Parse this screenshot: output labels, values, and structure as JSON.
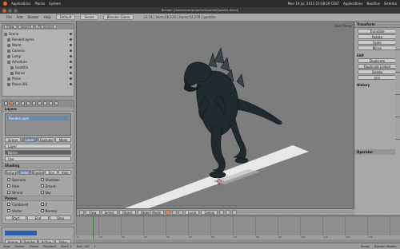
{
  "os_bar": {
    "app_name": "Applications",
    "menus": [
      "Places",
      "System"
    ],
    "right_items": [
      "Mon 19 Jul, 2013 22:38:20 CEST",
      "Applications",
      "Nautilus",
      "Sistema"
    ]
  },
  "window": {
    "title": "Blender [/home/user/projects/Godzilla/Godzilla.blend]"
  },
  "info_bar": {
    "menus": [
      "File",
      "Add",
      "Render",
      "Help"
    ],
    "layout": "Default",
    "scene": "Scene",
    "engine": "Blender Game",
    "stats": "v2.74 | Verts:26,126 | Faces:52,279 | godzilla"
  },
  "outliner": {
    "header_items": [
      "View",
      "Search",
      "All Scenes"
    ],
    "rows": [
      "Scene",
      "RenderLayers",
      "World",
      "Camera",
      "Lamp",
      "Armature",
      "Godzilla",
      "Bones",
      "Plane",
      "Plane.001"
    ]
  },
  "properties": {
    "layers_title": "Layers",
    "passes_title": "Render Layers",
    "list_selected": "RenderLayer",
    "buttons_row1": [
      "Scene",
      "Layer",
      "Exclude",
      "Mask"
    ],
    "field_layer": "Layer",
    "field_name": "Name",
    "field_use": "Use",
    "shading_title": "Shading",
    "shading_buttons": [
      "Texture",
      "Solid",
      "Shadow",
      "Env",
      "Halo"
    ],
    "checks": [
      "Specular",
      "Shadows",
      "Halo",
      "Zmask",
      "Strand",
      "Sky"
    ],
    "passes_label": "Passes",
    "passes_checks": [
      "Combined",
      "Z",
      "Vector",
      "Normal"
    ],
    "frame_buttons": [
      "Start",
      "End",
      "Step"
    ],
    "bottom_buttons": [
      "Image",
      "Render",
      "Active",
      "Bake"
    ]
  },
  "viewport": {
    "label": "User Persp",
    "header": [
      "View",
      "Select",
      "Object",
      "Object Mode",
      "Local",
      "Global"
    ],
    "mesh_name": "Godzilla"
  },
  "toolshelf": {
    "title": "Transform",
    "tools": [
      "Translate",
      "Rotate",
      "Scale",
      "Mirror"
    ],
    "edit_title": "Edit",
    "edit_tools": [
      "Duplicate",
      "Duplicate Linked",
      "Delete",
      "Join"
    ],
    "history_title": "History",
    "options_title": "Operator"
  },
  "timeline": {
    "ruler": [
      "0",
      "10",
      "20",
      "30",
      "40",
      "50",
      "60",
      "70",
      "80",
      "90",
      "100",
      "110",
      "120",
      "130"
    ],
    "header": [
      "View",
      "Marker",
      "Frame",
      "Playback",
      "Start: 1",
      "End: 250",
      "1"
    ]
  },
  "status": {
    "left": "Ready",
    "right": "Blender Render"
  },
  "colors": {
    "accent": "#e6884a",
    "selection": "#6e87a8",
    "viewport": "#7d7d7d",
    "floor": "#e8e8e8",
    "creature": "#1f2a2e"
  }
}
